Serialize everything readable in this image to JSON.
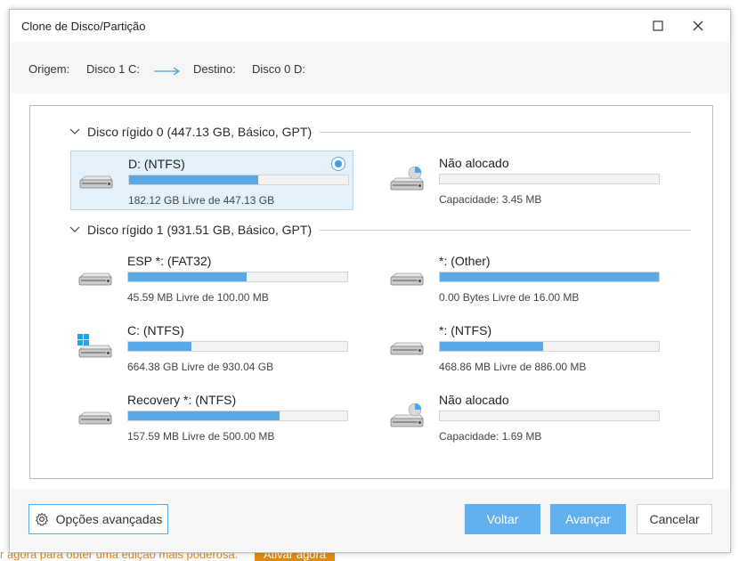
{
  "background": {
    "promo_text": "r agora para obter uma edição mais poderosa.",
    "promo_button": "Ativar agora"
  },
  "window": {
    "title": "Clone de Disco/Partição"
  },
  "route": {
    "origin_label": "Origem:",
    "origin_value": "Disco 1 C:",
    "dest_label": "Destino:",
    "dest_value": "Disco 0 D:"
  },
  "disks": [
    {
      "header": "Disco rígido 0 (447.13 GB, Básico, GPT)",
      "partitions": [
        {
          "name": "D: (NTFS)",
          "info": "182.12 GB Livre de 447.13 GB",
          "used_fraction": 0.593,
          "icon": "drive-icon",
          "selected": true
        },
        {
          "name": "Não alocado",
          "info": "Capacidade: 3.45 MB",
          "used_fraction": 0.0,
          "icon": "unallocated-drive-icon",
          "selected": false
        }
      ]
    },
    {
      "header": "Disco rígido 1 (931.51 GB, Básico, GPT)",
      "partitions": [
        {
          "name": "ESP *: (FAT32)",
          "info": "45.59 MB Livre de 100.00 MB",
          "used_fraction": 0.544,
          "icon": "drive-icon",
          "selected": false
        },
        {
          "name": "*: (Other)",
          "info": "0.00 Bytes Livre de 16.00 MB",
          "used_fraction": 1.0,
          "icon": "drive-icon",
          "selected": false
        },
        {
          "name": "C: (NTFS)",
          "info": "664.38 GB Livre de 930.04 GB",
          "used_fraction": 0.286,
          "icon": "windows-drive-icon",
          "selected": false
        },
        {
          "name": "*: (NTFS)",
          "info": "468.86 MB Livre de 886.00 MB",
          "used_fraction": 0.471,
          "icon": "drive-icon",
          "selected": false
        },
        {
          "name": "Recovery *: (NTFS)",
          "info": "157.59 MB Livre de 500.00 MB",
          "used_fraction": 0.685,
          "icon": "drive-icon",
          "selected": false
        },
        {
          "name": "Não alocado",
          "info": "Capacidade: 1.69 MB",
          "used_fraction": 0.0,
          "icon": "unallocated-drive-icon",
          "selected": false
        }
      ]
    }
  ],
  "footer": {
    "advanced_label": "Opções avançadas",
    "back_label": "Voltar",
    "next_label": "Avançar",
    "cancel_label": "Cancelar"
  },
  "colors": {
    "accent": "#5aa8e6",
    "selected_bg": "#e4f0fa",
    "promo": "#e28a14"
  }
}
